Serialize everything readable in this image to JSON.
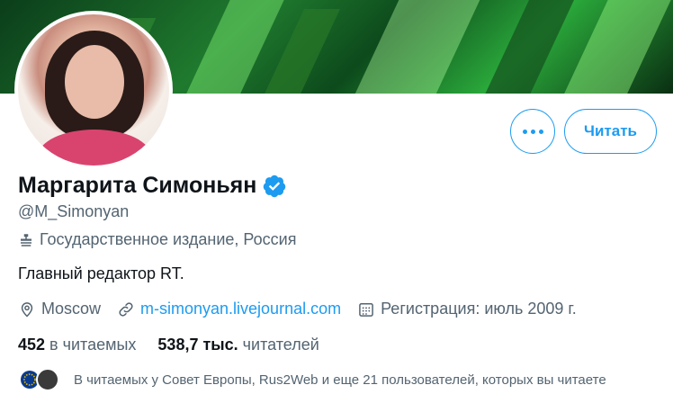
{
  "profile": {
    "name": "Маргарита Симоньян",
    "handle": "@M_Simonyan",
    "label": "Государственное издание, Россия",
    "bio": "Главный редактор RT.",
    "location": "Moscow",
    "website": "m-simonyan.livejournal.com",
    "joined": "Регистрация: июль 2009 г.",
    "verified": true
  },
  "actions": {
    "follow_label": "Читать"
  },
  "stats": {
    "following_count": "452",
    "following_label": "в читаемых",
    "followers_count": "538,7 тыс.",
    "followers_label": "читателей"
  },
  "followed_by": {
    "text": "В читаемых у Совет Европы, Rus2Web и еще 21 пользователей, которых вы читаете"
  },
  "colors": {
    "accent": "#1d9bf0",
    "text_primary": "#0f1419",
    "text_secondary": "#536471"
  },
  "icons": [
    "more-icon",
    "verified-badge-icon",
    "government-label-icon",
    "location-icon",
    "link-icon",
    "calendar-icon"
  ]
}
